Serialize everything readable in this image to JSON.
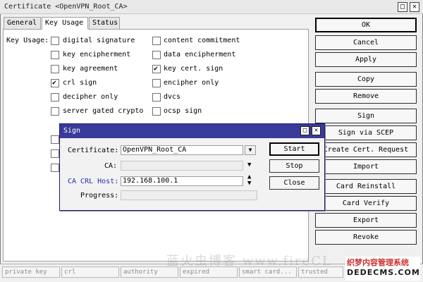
{
  "window": {
    "title": "Certificate <OpenVPN_Root_CA>",
    "maximize_glyph": "□",
    "close_glyph": "✕"
  },
  "tabs": [
    {
      "label": "General"
    },
    {
      "label": "Key Usage"
    },
    {
      "label": "Status"
    }
  ],
  "key_usage": {
    "label": "Key Usage:",
    "left": [
      {
        "label": "digital signature",
        "checked": false
      },
      {
        "label": "key encipherment",
        "checked": false
      },
      {
        "label": "key agreement",
        "checked": false
      },
      {
        "label": "crl sign",
        "checked": true
      },
      {
        "label": "decipher only",
        "checked": false
      },
      {
        "label": "server gated crypto",
        "checked": false
      }
    ],
    "right": [
      {
        "label": "content commitment",
        "checked": false
      },
      {
        "label": "data encipherment",
        "checked": false
      },
      {
        "label": "key cert. sign",
        "checked": true
      },
      {
        "label": "encipher only",
        "checked": false
      },
      {
        "label": "dvcs",
        "checked": false
      },
      {
        "label": "ocsp sign",
        "checked": false
      }
    ]
  },
  "buttons": [
    "OK",
    "Cancel",
    "Apply",
    "Copy",
    "Remove",
    "Sign",
    "Sign via SCEP",
    "Create Cert. Request",
    "Import",
    "Card Reinstall",
    "Card Verify",
    "Export",
    "Revoke"
  ],
  "status_bar": [
    "private key",
    "crl",
    "authority",
    "expired",
    "smart card...",
    "trusted"
  ],
  "dialog": {
    "title": "Sign",
    "certificate_label": "Certificate:",
    "certificate_value": "OpenVPN_Root_CA",
    "ca_label": "CA:",
    "ca_value": "",
    "crl_host_label": "CA CRL Host:",
    "crl_host_value": "192.168.100.1",
    "progress_label": "Progress:",
    "progress_value": "",
    "start_label": "Start",
    "stop_label": "Stop",
    "close_label": "Close"
  },
  "watermark": {
    "left_text": "蓝火虫博客 www.fireCL",
    "brand_cn": "织梦内容管理系统",
    "brand_en": "DEDECMS.COM"
  },
  "colors": {
    "dialog_title": "#3a3a9a",
    "crl_label": "#1f2fb5"
  }
}
